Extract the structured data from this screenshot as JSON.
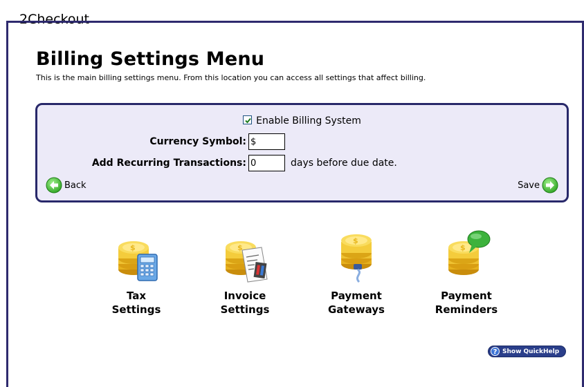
{
  "brand": "2Checkout",
  "page": {
    "title": "Billing Settings Menu",
    "description": "This is the main billing settings menu. From this location you can access all settings that affect billing."
  },
  "panel": {
    "enable_label": "Enable Billing System",
    "enable_checked": true,
    "currency_label": "Currency Symbol:",
    "currency_value": "$",
    "recurring_label": "Add Recurring Transactions:",
    "recurring_value": "0",
    "recurring_suffix": "days before due date.",
    "back_label": "Back",
    "save_label": "Save"
  },
  "icons": [
    {
      "name": "tax-settings",
      "line1": "Tax",
      "line2": "Settings",
      "icon": "coins-calculator-icon"
    },
    {
      "name": "invoice-settings",
      "line1": "Invoice",
      "line2": "Settings",
      "icon": "coins-invoice-icon"
    },
    {
      "name": "payment-gateways",
      "line1": "Payment",
      "line2": "Gateways",
      "icon": "coins-plug-icon"
    },
    {
      "name": "payment-reminders",
      "line1": "Payment",
      "line2": "Reminders",
      "icon": "coins-speech-bubble-icon"
    }
  ],
  "quickhelp_label": "Show QuickHelp",
  "colors": {
    "frame": "#2e2a6e",
    "panel_bg": "#eceaf8",
    "panel_border": "#28286a",
    "arrow_green": "#3dbb2f",
    "gold": "#e8b820"
  }
}
